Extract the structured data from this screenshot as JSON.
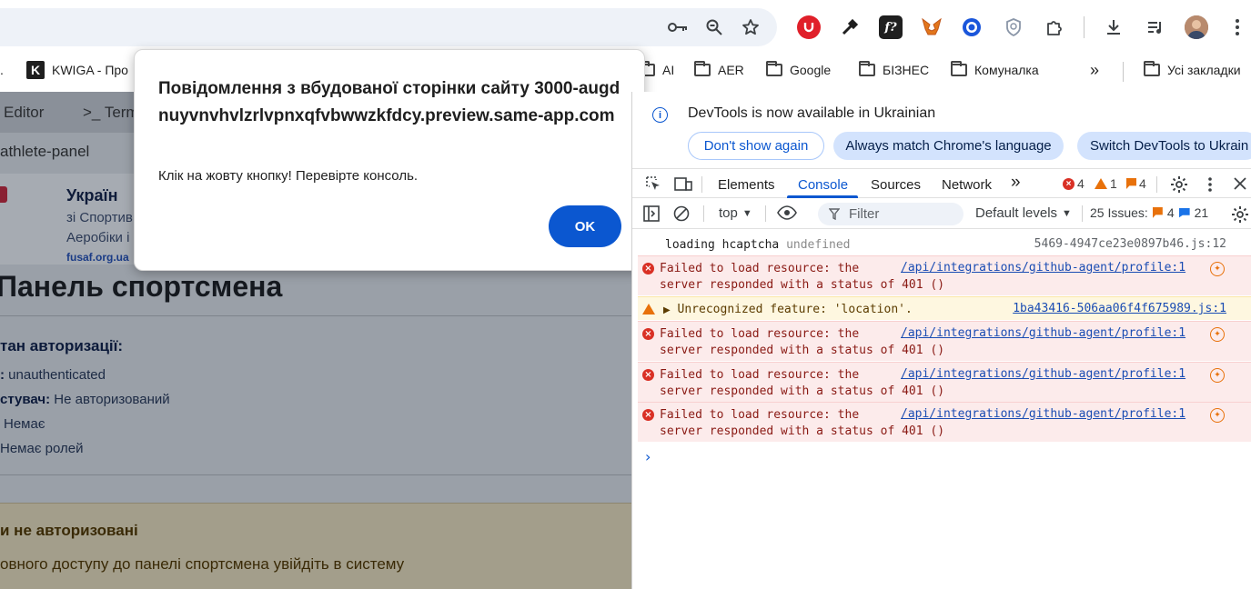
{
  "browser": {
    "toolbar_icons": [
      "key-icon",
      "zoom-icon",
      "star-icon"
    ],
    "extensions": [
      "ublock-icon",
      "eyedropper-icon",
      "formula-icon",
      "metamask-icon",
      "target-icon",
      "shield-icon",
      "puzzle-icon"
    ],
    "right_icons": [
      "download-icon",
      "media-icon",
      "profile-avatar",
      "menu-icon"
    ]
  },
  "bookmarks": {
    "lead": ".",
    "kwiga": "KWIGA - Про",
    "items": [
      "AI",
      "AER",
      "Google",
      "БІЗНЕС",
      "Комуналка"
    ],
    "overflow": "»",
    "all_bookmarks": "Усі закладки"
  },
  "page": {
    "tab_editor": "Editor",
    "tab_terminal": "Term",
    "terminal_prompt": ">_",
    "path": "athlete-panel",
    "org_name": "Україн",
    "org_line1": "зі Спортив",
    "org_line2": "Аеробіки і",
    "org_site": "fusaf.org.ua",
    "title": "Панель спортсмена",
    "status_heading": "тан авторизації:",
    "status_label": ":",
    "status_value": "unauthenticated",
    "user_label": "стувач:",
    "user_value": "Не авторизований",
    "roles_a": "Немає",
    "roles_b": "Немає ролей",
    "warn_title": "и не авторизовані",
    "warn_text": "овного доступу до панелі спортсмена увійдіть в систему"
  },
  "dialog": {
    "title": "Повідомлення з вбудованої сторінки сайту 3000-augdnuyvnvhvlzrlvpnxqfvbwwzkfdcy.preview.same-app.com",
    "message": "Клік на жовту кнопку! Перевірте консоль.",
    "ok": "OK"
  },
  "devtools": {
    "info_text": "DevTools is now available in Ukrainian",
    "btn_dont_show": "Don't show again",
    "btn_always_match": "Always match Chrome's language",
    "btn_switch": "Switch DevTools to Ukrain",
    "tabs": [
      "Elements",
      "Console",
      "Sources",
      "Network"
    ],
    "more_tabs": "»",
    "error_count": "4",
    "warning_count": "1",
    "issue_count": "4",
    "context": "top",
    "filter_placeholder": "Filter",
    "levels": "Default levels",
    "issues_label": "25 Issues:",
    "issues_warn": "4",
    "issues_info": "21",
    "console": [
      {
        "type": "log",
        "text": "loading hcaptcha",
        "extra": "undefined",
        "source": "5469-4947ce23e0897b46.js:12"
      },
      {
        "type": "error",
        "text": "Failed to load resource: the\nserver responded with a status of 401 ()",
        "source": "/api/integrations/github-agent/profile:1"
      },
      {
        "type": "warning",
        "text": "Unrecognized feature: 'location'.",
        "source": "1ba43416-506aa06f4f675989.js:1"
      },
      {
        "type": "error",
        "text": "Failed to load resource: the\nserver responded with a status of 401 ()",
        "source": "/api/integrations/github-agent/profile:1"
      },
      {
        "type": "error",
        "text": "Failed to load resource: the\nserver responded with a status of 401 ()",
        "source": "/api/integrations/github-agent/profile:1"
      },
      {
        "type": "error",
        "text": "Failed to load resource: the\nserver responded with a status of 401 ()",
        "source": "/api/integrations/github-agent/profile:1"
      }
    ],
    "prompt": "›"
  },
  "colors": {
    "accent": "#0b57d0",
    "error": "#d93025",
    "warning": "#e8710a",
    "error_bg": "#fcebeb",
    "warning_bg": "#fef7e0"
  }
}
